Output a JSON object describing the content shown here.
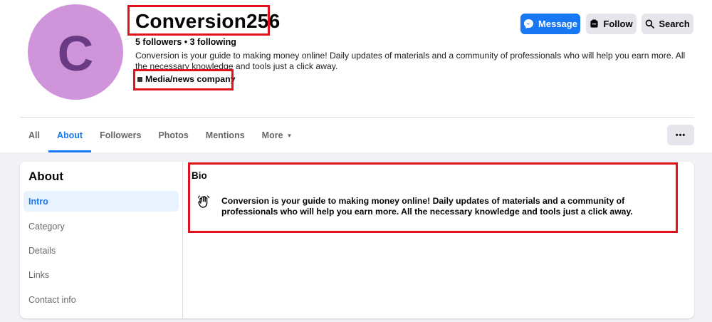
{
  "profile": {
    "avatar_letter": "C",
    "name": "Conversion256",
    "follow_stats": "5 followers • 3 following",
    "description": "Conversion is your guide to making money online! Daily updates of materials and a community of professionals who will help you earn more. All the necessary knowledge and tools just a click away.",
    "category": "Media/news company"
  },
  "actions": {
    "message_label": "Message",
    "follow_label": "Follow",
    "search_label": "Search",
    "more_label": "•••"
  },
  "tabs": [
    {
      "label": "All"
    },
    {
      "label": "About",
      "active": true
    },
    {
      "label": "Followers"
    },
    {
      "label": "Photos"
    },
    {
      "label": "Mentions"
    },
    {
      "label": "More"
    }
  ],
  "about": {
    "heading": "About",
    "items": [
      {
        "label": "Intro",
        "active": true
      },
      {
        "label": "Category"
      },
      {
        "label": "Details"
      },
      {
        "label": "Links"
      },
      {
        "label": "Contact info"
      }
    ]
  },
  "bio": {
    "title": "Bio",
    "text": "Conversion is your guide to making money online! Daily updates of materials and a community of professionals who will help you earn more. All the necessary knowledge and tools just a click away."
  },
  "colors": {
    "accent": "#1877f2",
    "highlight_box": "#e0121c",
    "avatar_bg": "#cf94da"
  },
  "icons": {
    "message": "messenger-icon",
    "follow": "follow-icon",
    "search": "search-icon",
    "bio": "waving-hand-icon",
    "category": "category-icon"
  }
}
